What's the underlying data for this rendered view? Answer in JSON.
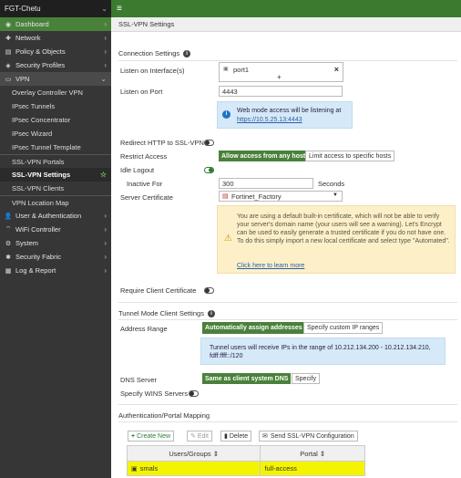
{
  "sidebar": {
    "device_name": "FGT-Chetu",
    "items": [
      {
        "label": "Dashboard",
        "icon": "dashboard-icon",
        "glyph": "◉"
      },
      {
        "label": "Network",
        "icon": "network-icon",
        "glyph": "✚"
      },
      {
        "label": "Policy & Objects",
        "icon": "policy-icon",
        "glyph": "▤"
      },
      {
        "label": "Security Profiles",
        "icon": "security-profiles-icon",
        "glyph": "◈"
      },
      {
        "label": "VPN",
        "icon": "vpn-icon",
        "glyph": "▭"
      }
    ],
    "vpn_sub": [
      "Overlay Controller VPN",
      "IPsec Tunnels",
      "IPsec Concentrator",
      "IPsec Wizard",
      "IPsec Tunnel Template",
      "SSL-VPN Portals",
      "SSL-VPN Settings",
      "SSL-VPN Clients",
      "VPN Location Map"
    ],
    "items_after": [
      {
        "label": "User & Authentication",
        "icon": "user-icon",
        "glyph": "👤"
      },
      {
        "label": "WiFi Controller",
        "icon": "wifi-icon",
        "glyph": "⌔"
      },
      {
        "label": "System",
        "icon": "system-gear-icon",
        "glyph": "⚙"
      },
      {
        "label": "Security Fabric",
        "icon": "security-fabric-icon",
        "glyph": "✱"
      },
      {
        "label": "Log & Report",
        "icon": "log-report-icon",
        "glyph": "▦"
      }
    ]
  },
  "topbar": {
    "menu_glyph": "≡"
  },
  "page": {
    "title": "SSL-VPN Settings"
  },
  "connection": {
    "title": "Connection Settings",
    "listen_iface_label": "Listen on Interface(s)",
    "iface_value": "port1",
    "listen_port_label": "Listen on Port",
    "port_value": "4443",
    "info_text": "Web mode access will be listening at",
    "info_link": "https://10.5.25.13:4443",
    "redirect_label": "Redirect HTTP to SSL-VPN",
    "restrict_label": "Restrict Access",
    "restrict_opt1": "Allow access from any host",
    "restrict_opt2": "Limit access to specific hosts",
    "idle_label": "Idle Logout",
    "inactive_label": "Inactive For",
    "inactive_value": "300",
    "seconds": "Seconds",
    "cert_label": "Server Certificate",
    "cert_value": "Fortinet_Factory",
    "warn_text": "You are using a default built-in certificate, which will not be able to verify your server's domain name (your users will see a warning). Let's Encrypt can be used to easily generate a trusted certificate if you do not have one. To do this simply import a new local certificate and select type \"Automated\".",
    "warn_link": "Click here to learn more",
    "client_cert_label": "Require Client Certificate"
  },
  "tunnel": {
    "title": "Tunnel Mode Client Settings",
    "range_label": "Address Range",
    "range_opt1": "Automatically assign addresses",
    "range_opt2": "Specify custom IP ranges",
    "range_info": "Tunnel users will receive IPs in the range of 10.212.134.200 - 10.212.134.210, fdff:ffff::/120",
    "dns_label": "DNS Server",
    "dns_opt1": "Same as client system DNS",
    "dns_opt2": "Specify",
    "wins_label": "Specify WINS Servers"
  },
  "mapping": {
    "title": "Authentication/Portal Mapping",
    "create": "Create New",
    "edit": "Edit",
    "delete": "Delete",
    "send": "Send SSL-VPN Configuration",
    "col1": "Users/Groups",
    "col2": "Portal",
    "row1_user": "smals",
    "row1_portal": "full-access"
  },
  "colors": {
    "brand_green": "#49813b",
    "highlight": "#f4f400",
    "sidebar_bg": "#363636"
  }
}
